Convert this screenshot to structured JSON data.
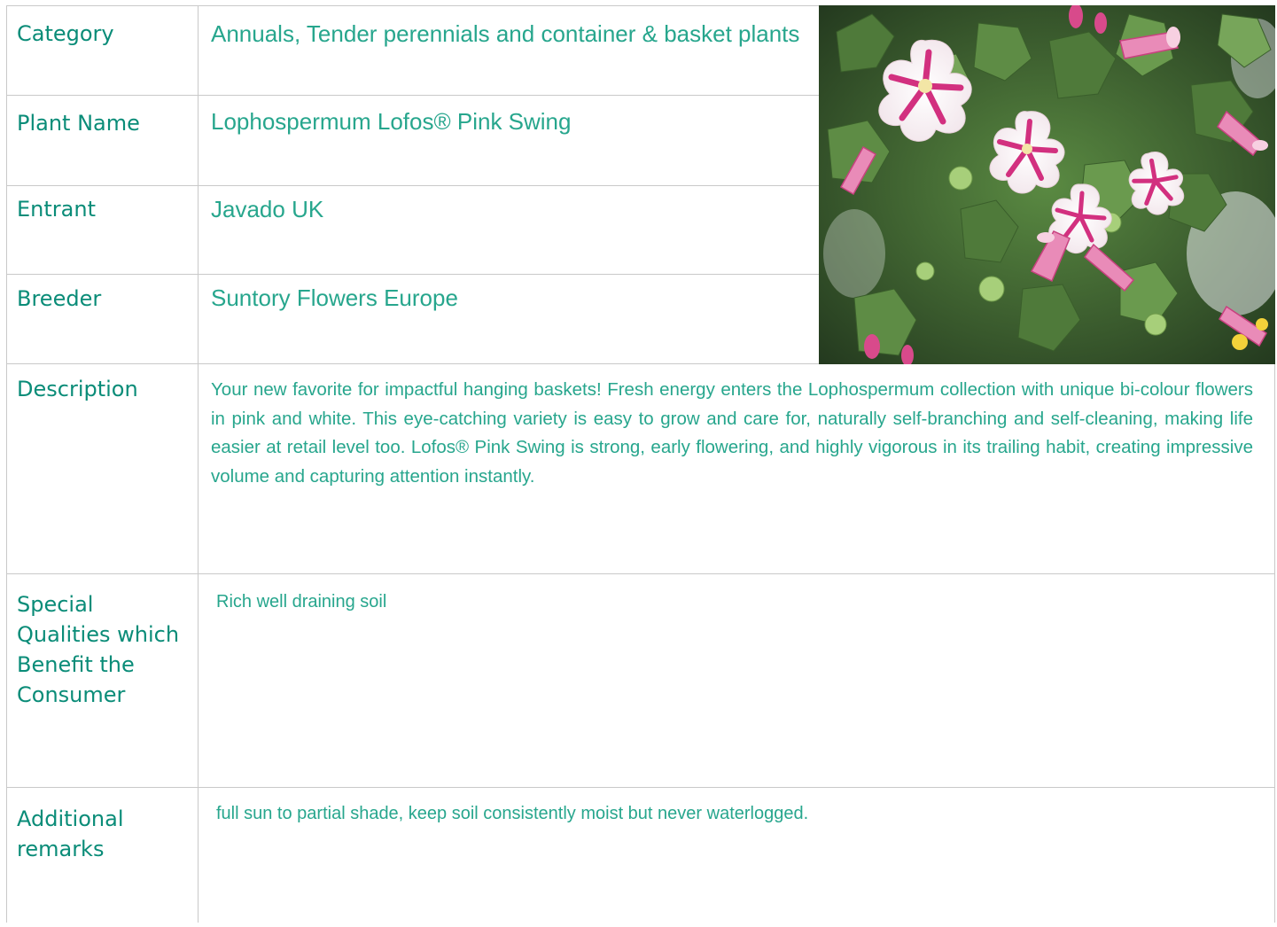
{
  "rows": {
    "category": {
      "label": "Category",
      "value": "Annuals, Tender perennials and container & basket plants"
    },
    "plant_name": {
      "label": "Plant Name",
      "value": "Lophospermum Lofos® Pink Swing"
    },
    "entrant": {
      "label": "Entrant",
      "value": "Javado UK"
    },
    "breeder": {
      "label": "Breeder",
      "value": "Suntory Flowers Europe"
    },
    "description": {
      "label": "Description",
      "value": "Your new favorite for impactful hanging baskets! Fresh energy enters the Lophospermum collection with unique bi-colour flowers in pink and white. This eye-catching variety is easy to grow and care for, naturally self-branching and self-cleaning, making life easier at retail level too. Lofos® Pink Swing is strong, early flowering, and highly vigorous in its trailing habit, creating impressive volume and capturing attention instantly."
    },
    "special_qualities": {
      "label": "Special Qualities which Benefit the Consumer",
      "value": "Rich well draining soil"
    },
    "additional_remarks": {
      "label": "Additional remarks",
      "value": "full sun to partial shade, keep soil consistently moist but never waterlogged."
    }
  },
  "colors": {
    "label_text": "#0a8c78",
    "value_text": "#27a68d",
    "grid": "#c9c9c9",
    "petal_white": "#f7f2f4",
    "petal_pink": "#d2307f",
    "foliage": "#4f7a3a"
  }
}
